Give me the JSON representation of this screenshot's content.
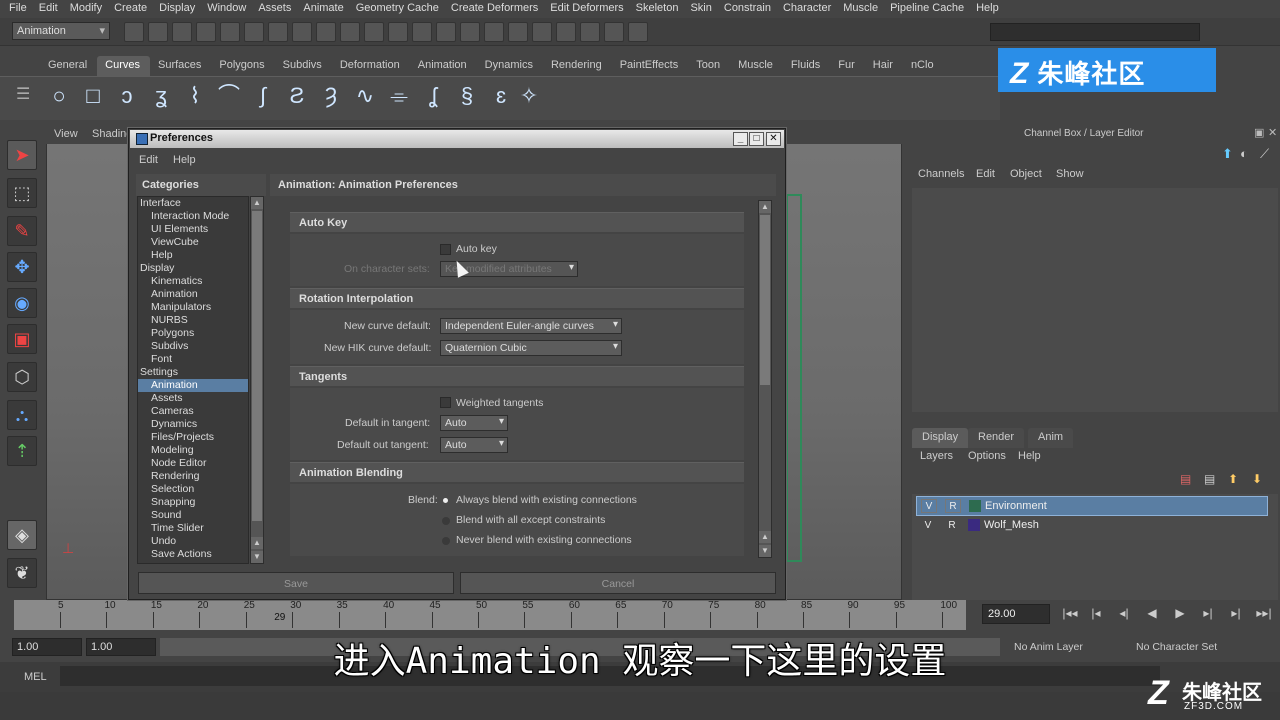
{
  "app": {
    "menu": [
      "File",
      "Edit",
      "Modify",
      "Create",
      "Display",
      "Window",
      "Assets",
      "Animate",
      "Geometry Cache",
      "Create Deformers",
      "Edit Deformers",
      "Skeleton",
      "Skin",
      "Constrain",
      "Character",
      "Muscle",
      "Pipeline Cache",
      "Help"
    ],
    "mode": "Animation",
    "shelf_tabs": [
      "General",
      "Curves",
      "Surfaces",
      "Polygons",
      "Subdivs",
      "Deformation",
      "Animation",
      "Dynamics",
      "Rendering",
      "PaintEffects",
      "Toon",
      "Muscle",
      "Fluids",
      "Fur",
      "Hair",
      "nClo"
    ],
    "active_shelf_tab": "Curves",
    "viewport_menu": [
      "View",
      "Shading"
    ]
  },
  "channel_box": {
    "title": "Channel Box / Layer Editor",
    "menu": [
      "Channels",
      "Edit",
      "Object",
      "Show"
    ],
    "layer_tabs": [
      "Display",
      "Render",
      "Anim"
    ],
    "layer_menu": [
      "Layers",
      "Options",
      "Help"
    ],
    "layers": [
      {
        "v": "V",
        "r": "R",
        "name": "Environment",
        "color": "#2d6b4f",
        "selected": true
      },
      {
        "v": "V",
        "r": "R",
        "name": "Wolf_Mesh",
        "color": "#3a2a80",
        "selected": false
      }
    ]
  },
  "timeline": {
    "ticks": [
      "5",
      "10",
      "15",
      "20",
      "25",
      "30",
      "35",
      "40",
      "45",
      "50",
      "55",
      "60",
      "65",
      "70",
      "75",
      "80",
      "85",
      "90",
      "95",
      "100"
    ],
    "current_label": "29",
    "current_frame": "29.00",
    "range_start": "1.00",
    "range_inner": "1.00",
    "anim_layer": "No Anim Layer",
    "character_set": "No Character Set",
    "mel_label": "MEL"
  },
  "dialog": {
    "title": "Preferences",
    "menu": [
      "Edit",
      "Help"
    ],
    "categories_label": "Categories",
    "categories": [
      {
        "label": "Interface",
        "level": 0
      },
      {
        "label": "Interaction Mode",
        "level": 1
      },
      {
        "label": "UI Elements",
        "level": 1
      },
      {
        "label": "ViewCube",
        "level": 1
      },
      {
        "label": "Help",
        "level": 1
      },
      {
        "label": "Display",
        "level": 0
      },
      {
        "label": "Kinematics",
        "level": 1
      },
      {
        "label": "Animation",
        "level": 1
      },
      {
        "label": "Manipulators",
        "level": 1
      },
      {
        "label": "NURBS",
        "level": 1
      },
      {
        "label": "Polygons",
        "level": 1
      },
      {
        "label": "Subdivs",
        "level": 1
      },
      {
        "label": "Font",
        "level": 1
      },
      {
        "label": "Settings",
        "level": 0
      },
      {
        "label": "Animation",
        "level": 1,
        "selected": true
      },
      {
        "label": "Assets",
        "level": 1
      },
      {
        "label": "Cameras",
        "level": 1
      },
      {
        "label": "Dynamics",
        "level": 1
      },
      {
        "label": "Files/Projects",
        "level": 1
      },
      {
        "label": "Modeling",
        "level": 1
      },
      {
        "label": "Node Editor",
        "level": 1
      },
      {
        "label": "Rendering",
        "level": 1
      },
      {
        "label": "Selection",
        "level": 1
      },
      {
        "label": "Snapping",
        "level": 1
      },
      {
        "label": "Sound",
        "level": 1
      },
      {
        "label": "Time Slider",
        "level": 1
      },
      {
        "label": "Undo",
        "level": 1
      },
      {
        "label": "Save Actions",
        "level": 1
      }
    ],
    "pane_title": "Animation: Animation Preferences",
    "auto_key": {
      "section": "Auto Key",
      "checkbox": "Auto key",
      "on_character_sets_label": "On character sets:",
      "on_character_sets_value": "Key modified attributes"
    },
    "rotation": {
      "section": "Rotation Interpolation",
      "new_curve_label": "New curve default:",
      "new_curve_value": "Independent Euler-angle curves",
      "new_hik_label": "New HIK curve default:",
      "new_hik_value": "Quaternion Cubic"
    },
    "tangents": {
      "section": "Tangents",
      "weighted": "Weighted tangents",
      "in_label": "Default in tangent:",
      "in_value": "Auto",
      "out_label": "Default out tangent:",
      "out_value": "Auto"
    },
    "blending": {
      "section": "Animation Blending",
      "blend_label": "Blend:",
      "options": [
        "Always blend with existing connections",
        "Blend with all except constraints",
        "Never blend with existing connections"
      ],
      "selected": 0
    },
    "save_label": "Save",
    "cancel_label": "Cancel"
  },
  "overlay": {
    "watermark_text": "朱峰社区",
    "subtitle": "进入Animation 观察一下这里的设置",
    "logo_text": "朱峰社区",
    "logo_url": "ZF3D.COM"
  }
}
